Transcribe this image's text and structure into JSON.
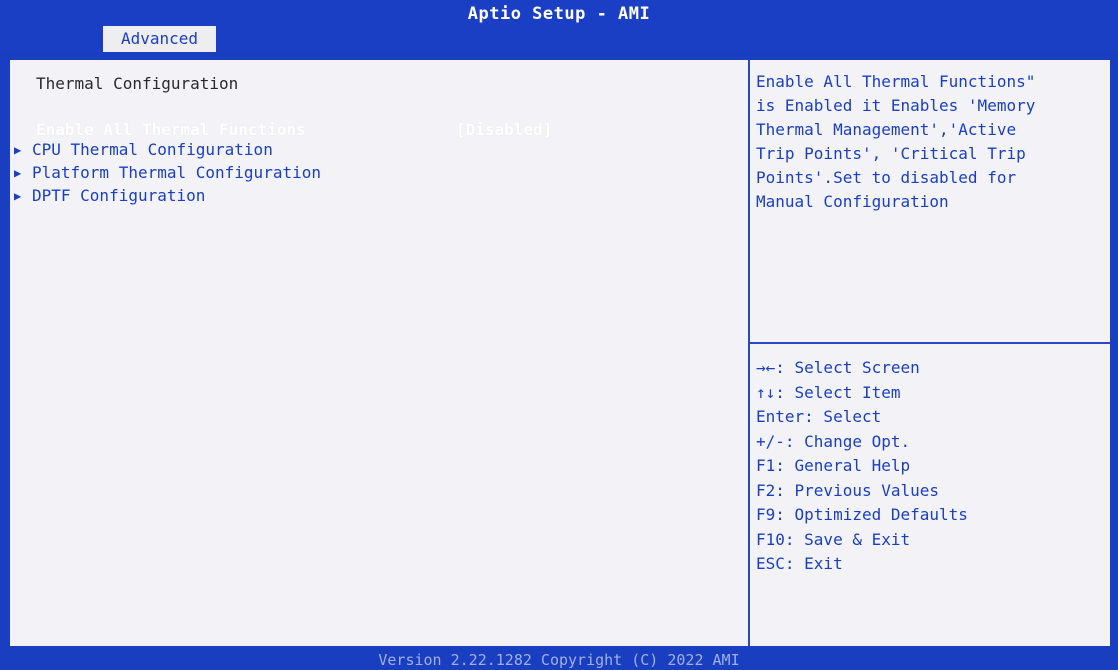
{
  "header": {
    "title": "Aptio Setup - AMI",
    "active_tab": "Advanced"
  },
  "main": {
    "section_title": "Thermal Configuration",
    "items": [
      {
        "label": "Enable All Thermal Functions",
        "value": "[Disabled]",
        "selected": true,
        "submenu": false
      },
      {
        "label": "CPU Thermal Configuration",
        "submenu": true
      },
      {
        "label": "Platform Thermal Configuration",
        "submenu": true
      },
      {
        "label": "DPTF Configuration",
        "submenu": true
      }
    ]
  },
  "help": {
    "description": "Enable All Thermal Functions\"\nis Enabled it Enables 'Memory\nThermal Management','Active\nTrip Points', 'Critical Trip\nPoints'.Set to disabled for\nManual Configuration",
    "keys": [
      "→←: Select Screen",
      "↑↓: Select Item",
      "Enter: Select",
      "+/-: Change Opt.",
      "F1: General Help",
      "F2: Previous Values",
      "F9: Optimized Defaults",
      "F10: Save & Exit",
      "ESC: Exit"
    ]
  },
  "footer": {
    "version": "Version 2.22.1282 Copyright (C) 2022 AMI"
  },
  "colors": {
    "bios_blue": "#1a3fc4",
    "panel_bg": "#f3f2f6",
    "highlight_text": "#ffffff"
  }
}
